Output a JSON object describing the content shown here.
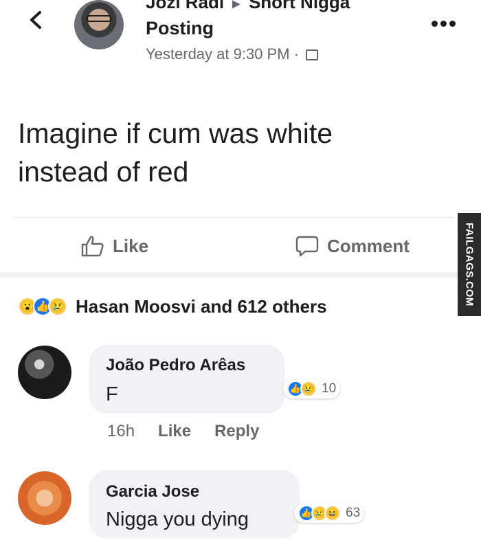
{
  "header": {
    "group_line_author": "Jozi Radi",
    "group_line_target": "Short Nigga",
    "subtitle": "Posting",
    "timestamp": "Yesterday at 9:30 PM ·"
  },
  "post": {
    "text_line1": "Imagine if cum was white",
    "text_line2": "instead of red"
  },
  "actions": {
    "like_label": "Like",
    "comment_label": "Comment"
  },
  "reactions_summary": {
    "text": "Hasan Moosvi and 612 others",
    "icons": [
      "wow-icon",
      "like-icon",
      "sad-icon"
    ]
  },
  "comments": [
    {
      "author": "João Pedro Arêas",
      "text": "F",
      "reaction_count": "10",
      "reaction_icons": [
        "like-icon",
        "sad-icon"
      ],
      "time": "16h",
      "like_label": "Like",
      "reply_label": "Reply"
    },
    {
      "author": "Garcia Jose",
      "text": "Nigga you dying",
      "reaction_count": "63",
      "reaction_icons": [
        "like-icon",
        "sad-icon",
        "haha-icon"
      ]
    }
  ],
  "watermark": "FAILGAGS.COM",
  "colors": {
    "facebook_blue": "#1877f2",
    "emoji_yellow": "#f7c94c",
    "secondary_text": "#65676b"
  }
}
